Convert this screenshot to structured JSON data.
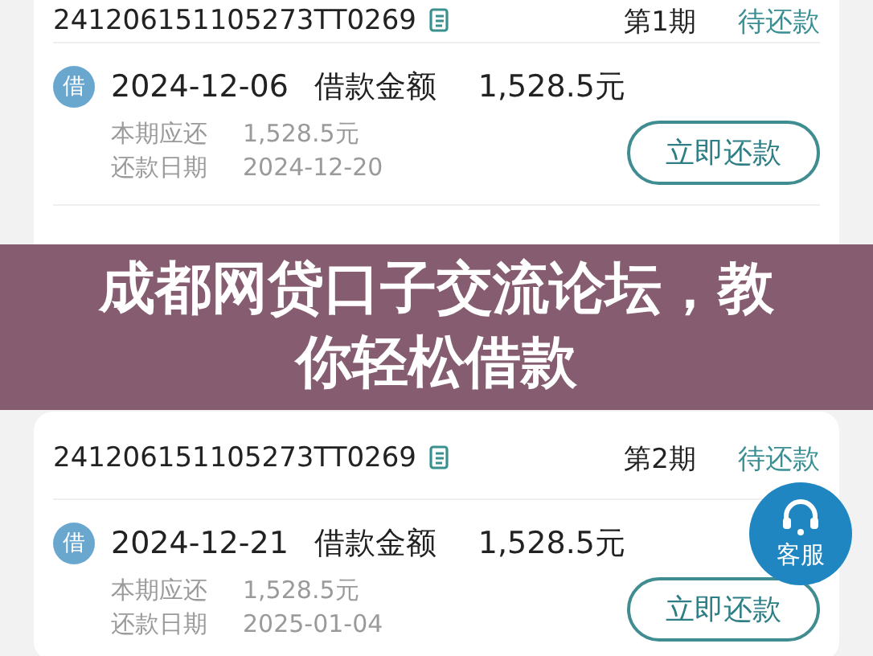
{
  "cards": [
    {
      "order_no": "241206151105273TT0269",
      "period": "第1期",
      "status": "待还款",
      "items": [
        {
          "kind": "loan",
          "badge": "借",
          "date": "2024-12-06",
          "type": "借款金额",
          "amount": "1,528.5元",
          "details": [
            {
              "label": "本期应还",
              "value": "1,528.5元"
            },
            {
              "label": "还款日期",
              "value": "2024-12-20"
            }
          ],
          "action": "立即还款"
        }
      ]
    },
    {
      "order_no": "241206151105273TT0269",
      "period": "第2期",
      "status": "待还款",
      "items": [
        {
          "kind": "loan",
          "badge": "借",
          "date": "2024-12-21",
          "type": "借款金额",
          "amount": "1,528.5元",
          "details": [
            {
              "label": "本期应还",
              "value": "1,528.5元"
            },
            {
              "label": "还款日期",
              "value": "2025-01-04"
            }
          ],
          "action": "立即还款"
        }
      ]
    }
  ],
  "support_button": {
    "label": "客服"
  },
  "banner": {
    "title": "成都网贷口子交流论坛，教你轻松借款"
  }
}
